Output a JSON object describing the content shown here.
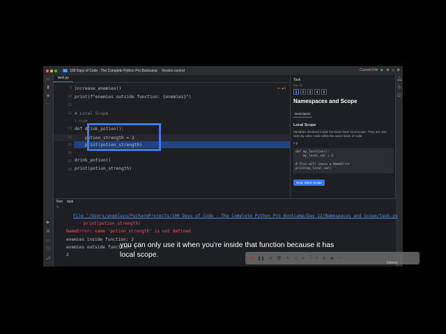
{
  "titlebar": {
    "project_badge": "1D",
    "project_name": "100 Days of Code - The Complete Python Pro Bootcamp",
    "vcs": "Version control",
    "run_config": "Current File"
  },
  "editor": {
    "tab": "task.py",
    "inspections": {
      "errors": "1",
      "warnings": "3"
    },
    "line_numbers": [
      "9",
      "10",
      "11",
      "12",
      "",
      "13",
      "14",
      "15",
      "16",
      "17",
      "18"
    ],
    "lines": [
      "increase_enemies()",
      "print(f\"enemies outside function: {enemies}\")",
      "",
      "# Local Scope",
      "1 usage",
      "def drink_potion():",
      "    potion_strength = 2",
      "    print(potion_strength)",
      "",
      "drink_potion()",
      "print(potion_strength)"
    ]
  },
  "task": {
    "header": "Task",
    "subheader": "Day 12",
    "steps": [
      "1",
      "2",
      "3",
      "4",
      "5"
    ],
    "title": "Namespaces and Scope",
    "tab": "Description",
    "section": "Local Scope",
    "para": "Variables declared inside functions have local scope. They are only seen by other code within the same block of code.",
    "eg": "e.g.",
    "code": "def my_function():\n    my_local_var = 2\n\n# This will cause a NameError\nprint(my_local_var)",
    "next_button": "Next: Block Scope"
  },
  "run": {
    "label": "Run",
    "config": "task",
    "output": [
      "File \"/Users/angelayu/PycharmProjects/100 Days of Code - The Complete Python Pro Bootcamp/Day 12/Namespaces and Scope/task.py",
      "    print(potion_strength)",
      "NameError: name 'potion_strength' is not defined",
      "enemies inside function: 2",
      "enemies outside function: 1",
      "2"
    ]
  },
  "subtitle": "you can only use it when you're inside that function because it has local scope.",
  "watermark": "Udemy"
}
